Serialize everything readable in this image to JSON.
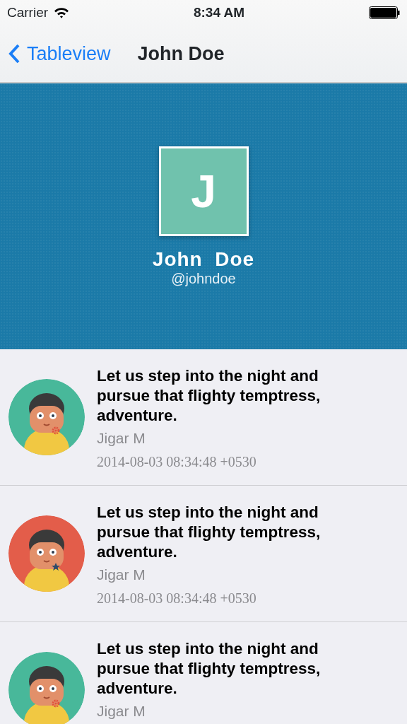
{
  "status_bar": {
    "carrier": "Carrier",
    "time": "8:34 AM"
  },
  "nav_bar": {
    "back_label": "Tableview",
    "title": "John Doe"
  },
  "profile": {
    "initial": "J",
    "name": "John  Doe",
    "handle": "@johndoe"
  },
  "posts": [
    {
      "text": "Let us step into the night and pursue that flighty temptress, adventure.",
      "author": "Jigar M",
      "date": "2014-08-03 08:34:48 +0530",
      "color": "#48b89a",
      "kind": "flower"
    },
    {
      "text": "Let us step into the night and pursue that flighty temptress, adventure.",
      "author": "Jigar M",
      "date": "2014-08-03 08:34:48 +0530",
      "color": "#e35d4a",
      "kind": "star"
    },
    {
      "text": "Let us step into the night and pursue that flighty temptress, adventure.",
      "author": "Jigar M",
      "color": "#48b89a",
      "kind": "flower"
    }
  ]
}
